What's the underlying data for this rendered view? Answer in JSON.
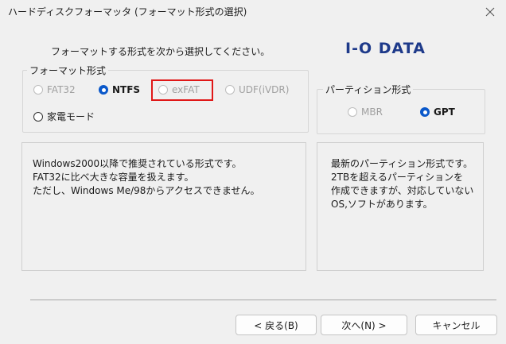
{
  "window": {
    "title": "ハードディスクフォーマッタ (フォーマット形式の選択)"
  },
  "instruction": "フォーマットする形式を次から選択してください。",
  "logo": "I-O DATA",
  "format_group": {
    "label": "フォーマット形式",
    "options": [
      {
        "label": "FAT32",
        "state": "disabled"
      },
      {
        "label": "NTFS",
        "state": "checked"
      },
      {
        "label": "exFAT",
        "state": "disabled"
      },
      {
        "label": "UDF(iVDR)",
        "state": "disabled"
      },
      {
        "label": "家電モード",
        "state": "enabled"
      }
    ]
  },
  "partition_group": {
    "label": "パーティション形式",
    "options": [
      {
        "label": "MBR",
        "state": "disabled"
      },
      {
        "label": "GPT",
        "state": "checked"
      }
    ]
  },
  "format_description": {
    "lines": [
      "Windows2000以降で推奨されている形式です。",
      "FAT32に比べ大きな容量を扱えます。",
      "ただし、Windows Me/98からアクセスできません。"
    ]
  },
  "partition_description": {
    "lines": [
      "最新のパーティション形式です。",
      "2TBを超えるパーティションを",
      "作成できますが、対応していない",
      "OS,ソフトがあります。"
    ]
  },
  "buttons": {
    "back": "< 戻る(B)",
    "next": "次へ(N) >",
    "cancel": "キャンセル"
  },
  "colors": {
    "accent": "#0a58ca",
    "highlight": "#e01818",
    "logo": "#1e3a8a"
  }
}
